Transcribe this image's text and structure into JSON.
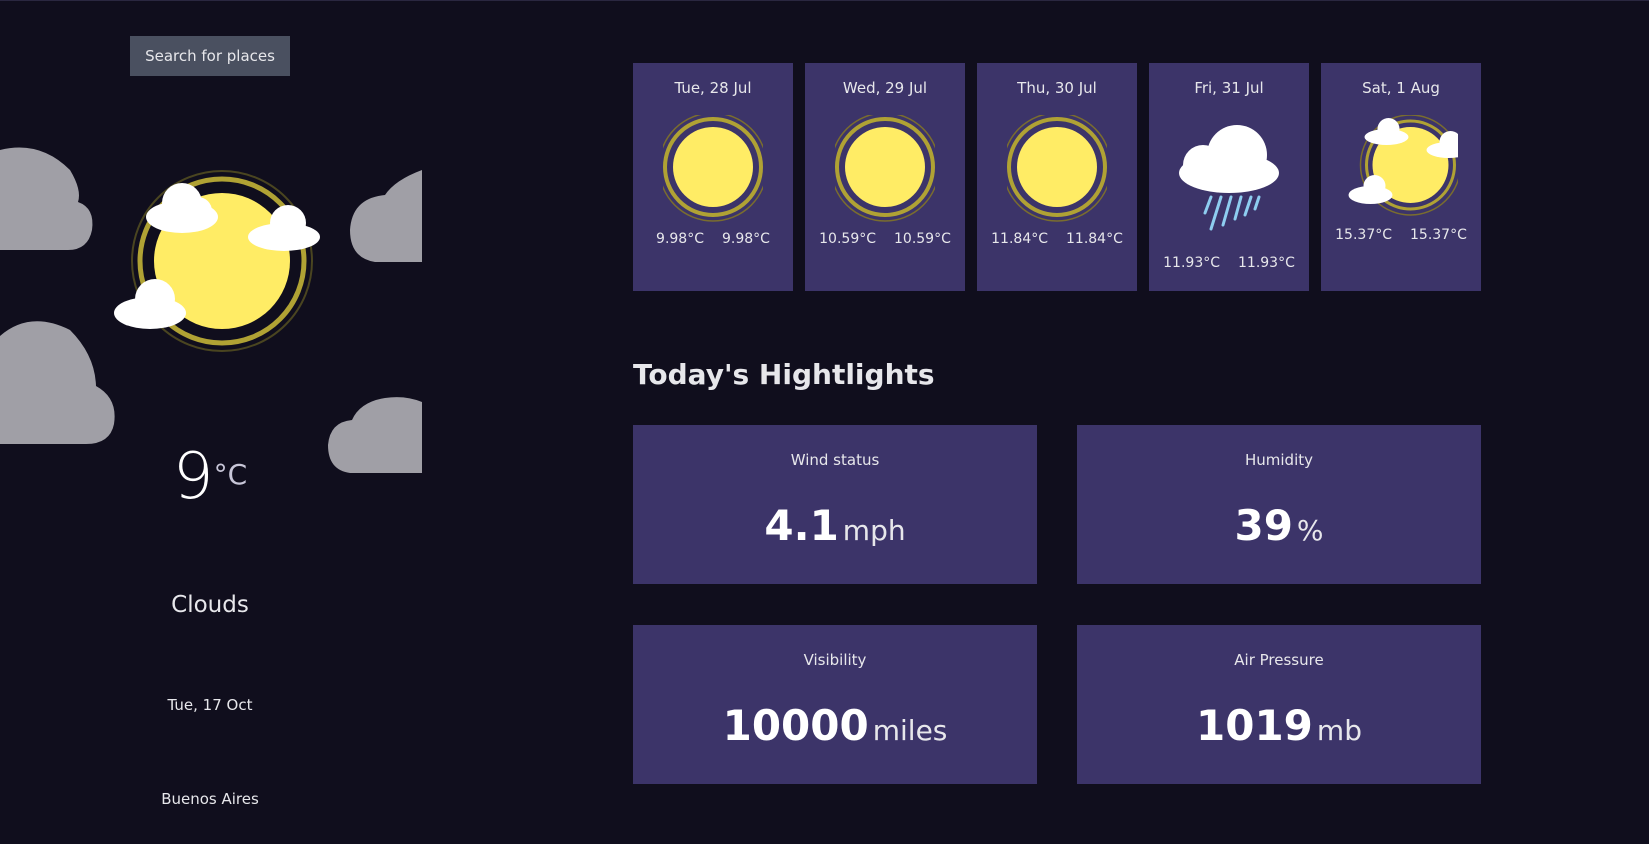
{
  "search": {
    "button_label": "Search for places"
  },
  "current": {
    "temperature": "9",
    "unit": "°C",
    "condition": "Clouds",
    "date": "Tue, 17 Oct",
    "location": "Buenos Aires",
    "icon": "sun-behind-clouds-icon"
  },
  "forecast": [
    {
      "date": "Tue, 28 Jul",
      "max": "9.98°C",
      "min": "9.98°C",
      "icon": "sun-icon"
    },
    {
      "date": "Wed, 29 Jul",
      "max": "10.59°C",
      "min": "10.59°C",
      "icon": "sun-icon"
    },
    {
      "date": "Thu, 30 Jul",
      "max": "11.84°C",
      "min": "11.84°C",
      "icon": "sun-icon"
    },
    {
      "date": "Fri, 31 Jul",
      "max": "11.93°C",
      "min": "11.93°C",
      "icon": "rain-cloud-icon"
    },
    {
      "date": "Sat, 1 Aug",
      "max": "15.37°C",
      "min": "15.37°C",
      "icon": "partly-cloudy-icon"
    }
  ],
  "highlights": {
    "title": "Today's Hightlights",
    "wind": {
      "label": "Wind status",
      "value": "4.1",
      "unit": "mph"
    },
    "humidity": {
      "label": "Humidity",
      "value": "39",
      "unit": "%"
    },
    "visibility": {
      "label": "Visibility",
      "value": "10000",
      "unit": "miles"
    },
    "pressure": {
      "label": "Air Pressure",
      "value": "1019",
      "unit": "mb"
    }
  },
  "colors": {
    "background": "#100e1d",
    "card": "#3c3469",
    "sun": "#ffec65",
    "cloud": "#a09fa6",
    "rain": "#8ecdf0"
  }
}
